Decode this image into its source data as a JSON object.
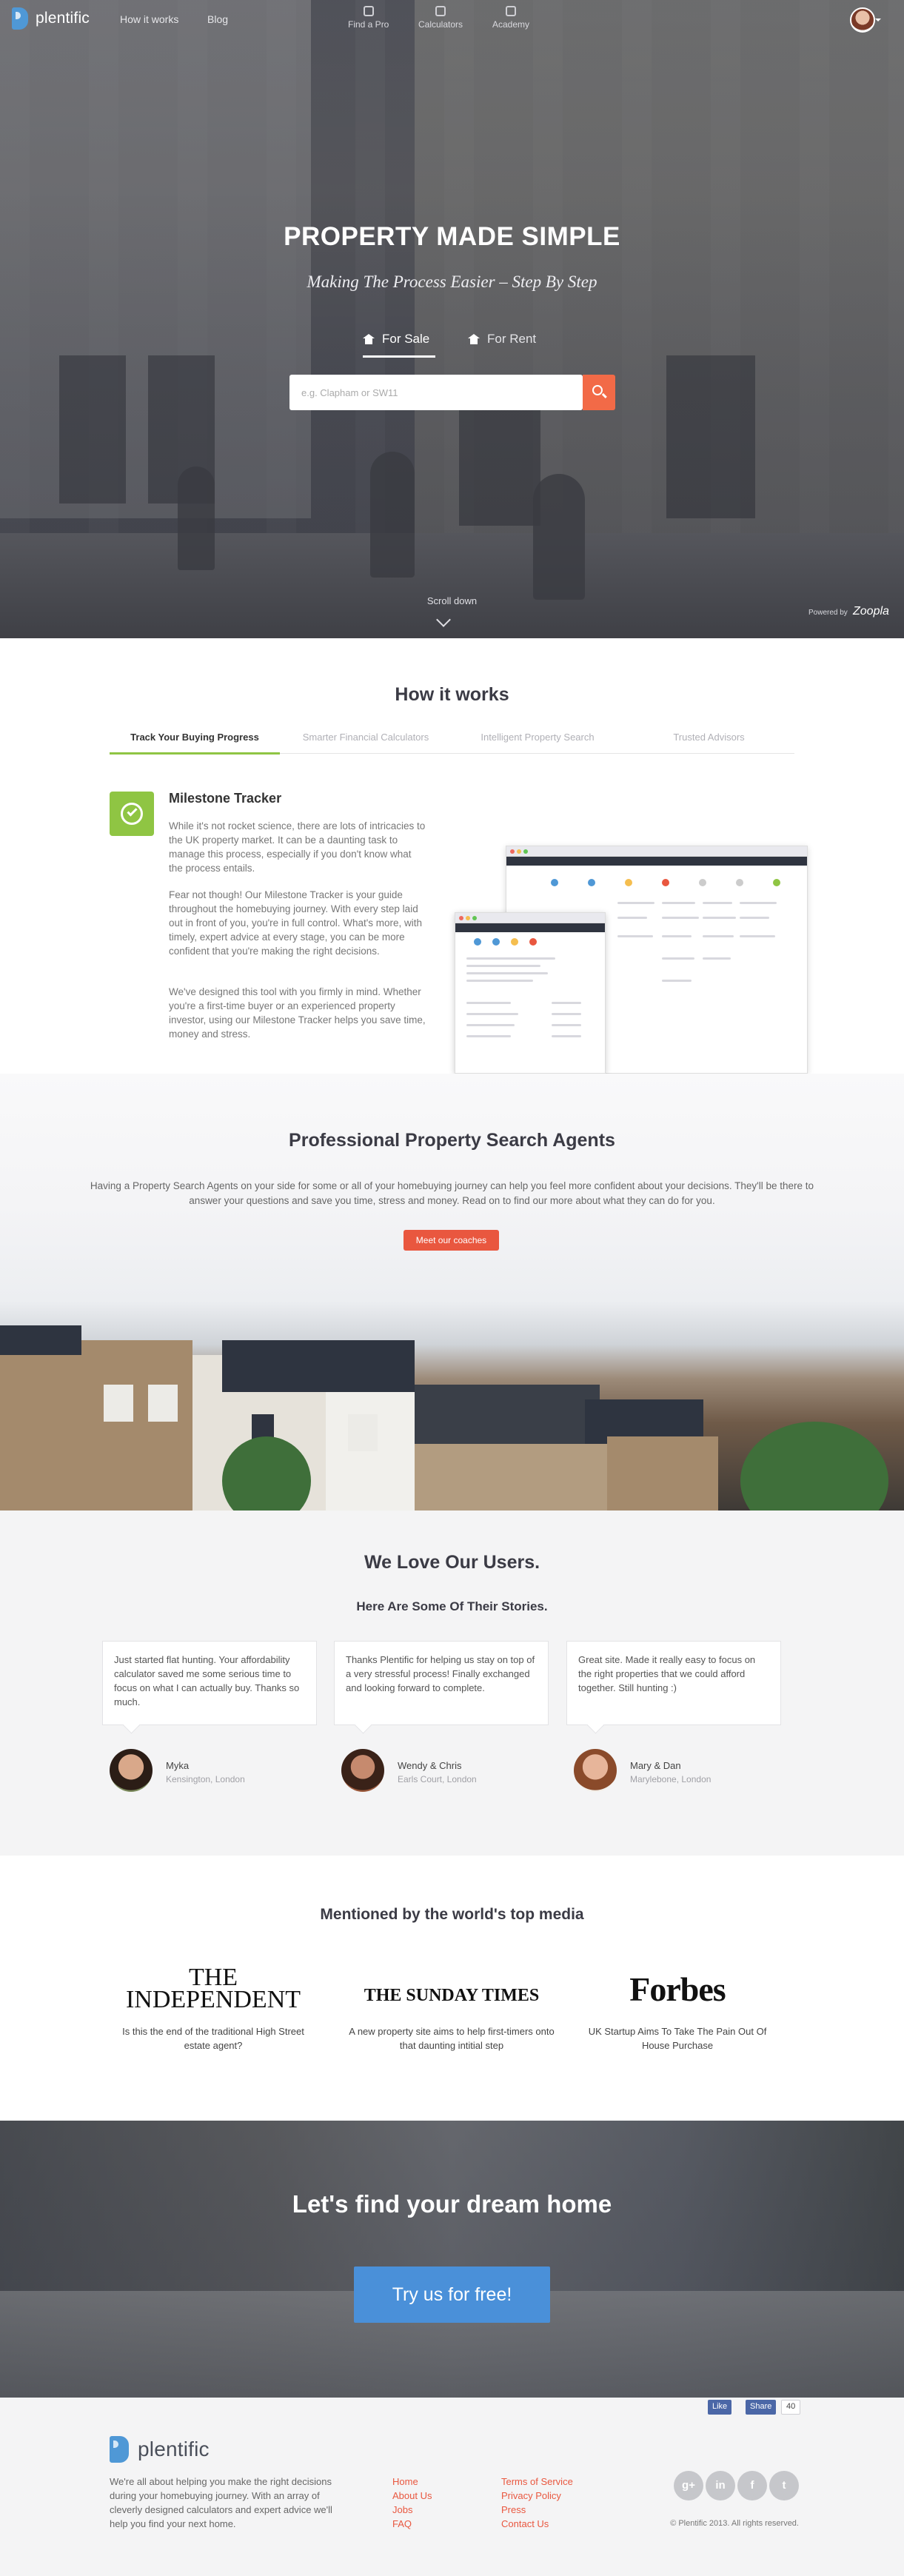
{
  "nav": {
    "brand": "plentific",
    "links": [
      "How it works",
      "Blog"
    ],
    "center_items": [
      {
        "label": "Find a Pro",
        "icon": "pro-icon"
      },
      {
        "label": "Calculators",
        "icon": "calculator-icon"
      },
      {
        "label": "Academy",
        "icon": "academy-icon"
      }
    ]
  },
  "hero": {
    "title": "PROPERTY MADE SIMPLE",
    "subtitle": "Making The Process Easier – Step By Step",
    "tabs": [
      "For Sale",
      "For Rent"
    ],
    "active_tab": "For Sale",
    "search_placeholder": "e.g. Clapham or SW11",
    "scroll_label": "Scroll down",
    "powered_by": "Powered by",
    "partner": "Zoopla"
  },
  "how": {
    "title": "How it works",
    "tabs": [
      "Track Your Buying Progress",
      "Smarter Financial Calculators",
      "Intelligent Property Search",
      "Trusted Advisors"
    ],
    "feature_title": "Milestone Tracker",
    "paragraphs": [
      "While it's not rocket science, there are lots of intricacies to the UK property market. It can be a daunting task to manage this process, especially if you don't know what the process entails.",
      "Fear not though! Our Milestone Tracker is your guide throughout the homebuying journey. With every step laid out in front of you, you're in full control. What's more, with timely, expert advice at every stage, you can be more confident that you're making the right decisions.",
      "We've designed this tool with you firmly in mind. Whether you're a first-time buyer or an experienced property investor, using our Milestone Tracker helps you save time, money and stress."
    ]
  },
  "agents": {
    "title": "Professional Property Search Agents",
    "body": "Having a Property Search Agents on your side for some or all of your homebuying journey can help you feel more confident about your decisions. They'll be there to answer your questions and save you time, stress and money. Read on to find our more about what they can do for you.",
    "button": "Meet our coaches"
  },
  "users": {
    "title": "We Love Our Users.",
    "subtitle": "Here Are Some Of Their Stories.",
    "testimonials": [
      {
        "quote": "Just started flat hunting. Your affordability calculator saved me some serious time to focus on what I can actually buy. Thanks so much.",
        "name": "Myka",
        "location": "Kensington, London"
      },
      {
        "quote": "Thanks Plentific for helping us stay on top of a very stressful process! Finally exchanged and looking forward to complete.",
        "name": "Wendy & Chris",
        "location": "Earls Court, London"
      },
      {
        "quote": "Great site. Made it really easy to focus on the right properties that we could afford together. Still hunting :)",
        "name": "Mary & Dan",
        "location": "Marylebone, London"
      }
    ]
  },
  "media": {
    "title": "Mentioned by the world's top media",
    "items": [
      {
        "logo_line1": "THE",
        "logo_line2": "INDEPENDENT",
        "caption": "Is this the end of the traditional High Street estate agent?"
      },
      {
        "logo_line1": "",
        "logo_line2": "THE SUNDAY TIMES",
        "caption": "A new property site aims to help first-timers onto that daunting intitial step"
      },
      {
        "logo_line1": "",
        "logo_line2": "Forbes",
        "caption": "UK Startup Aims To Take The Pain Out Of House Purchase"
      }
    ]
  },
  "cta": {
    "title": "Let's find your dream home",
    "button": "Try us for free!"
  },
  "footer": {
    "brand": "plentific",
    "description": "We're all about helping you make the right decisions during your homebuying journey. With an array of cleverly designed calculators and expert advice we'll help you find your next home.",
    "col1": [
      "Home",
      "About Us",
      "Jobs",
      "FAQ"
    ],
    "col2": [
      "Terms of Service",
      "Privacy Policy",
      "Press",
      "Contact Us"
    ],
    "fb_like": "Like",
    "fb_share": "Share",
    "fb_count": "40",
    "social": [
      "g+",
      "in",
      "f",
      "t"
    ],
    "copyright": "© Plentific 2013. All rights reserved."
  }
}
